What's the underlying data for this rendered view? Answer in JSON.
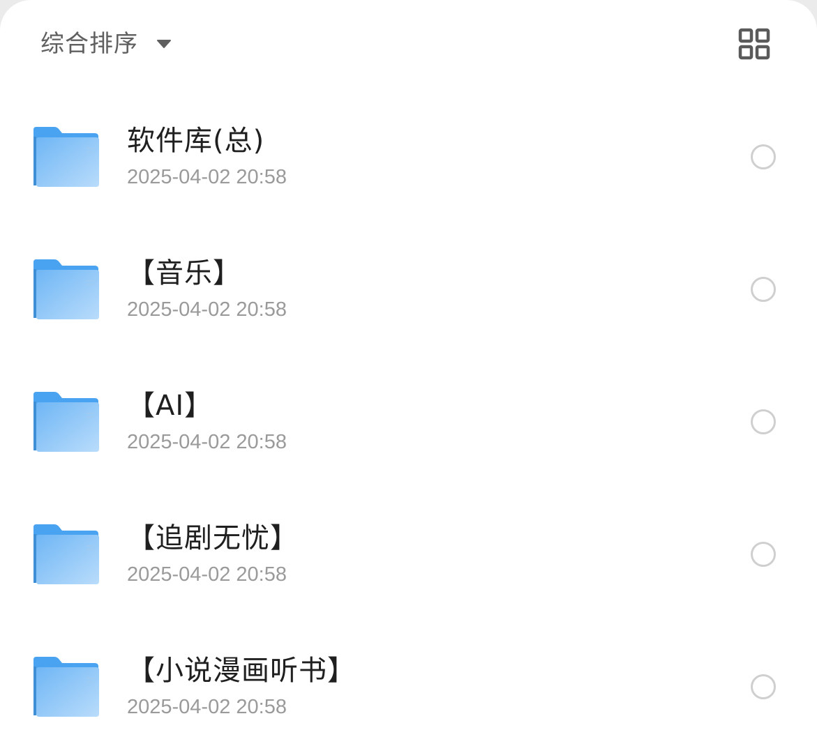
{
  "toolbar": {
    "sort_label": "综合排序",
    "sort_caret_icon": "caret-down-icon",
    "view_toggle_icon": "grid-view-icon"
  },
  "colors": {
    "folder_back": "#4aa3f0",
    "folder_front_top": "#6fb6f5",
    "folder_front_bottom": "#b9dcfb",
    "text_primary": "#1f1f1f",
    "text_secondary": "#9a9a9a",
    "radio_border": "#cfcfcf"
  },
  "files": [
    {
      "name": "软件库(总)",
      "date": "2025-04-02 20:58",
      "icon": "folder-icon"
    },
    {
      "name": "【音乐】",
      "date": "2025-04-02 20:58",
      "icon": "folder-icon"
    },
    {
      "name": "【AI】",
      "date": "2025-04-02 20:58",
      "icon": "folder-icon"
    },
    {
      "name": "【追剧无忧】",
      "date": "2025-04-02 20:58",
      "icon": "folder-icon"
    },
    {
      "name": "【小说漫画听书】",
      "date": "2025-04-02 20:58",
      "icon": "folder-icon"
    }
  ]
}
